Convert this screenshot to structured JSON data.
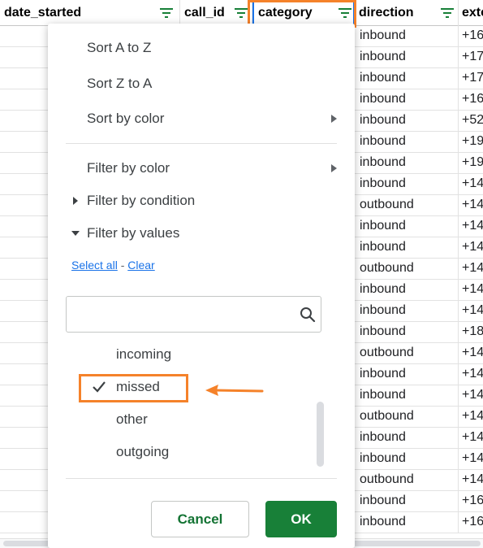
{
  "columns": [
    {
      "label": "date_started",
      "filter_icon": "filter-icon",
      "filter_active": false
    },
    {
      "label": "call_id",
      "filter_icon": "filter-icon",
      "filter_active": false
    },
    {
      "label": "category",
      "filter_icon": "filter-icon",
      "filter_active": true
    },
    {
      "label": "direction",
      "filter_icon": "filter-icon",
      "filter_active": false
    },
    {
      "label": "exte",
      "filter_icon": null,
      "filter_active": false
    }
  ],
  "rows": [
    {
      "direction": "inbound",
      "ext": "+16"
    },
    {
      "direction": "inbound",
      "ext": "+17"
    },
    {
      "direction": "inbound",
      "ext": "+17"
    },
    {
      "direction": "inbound",
      "ext": "+16"
    },
    {
      "direction": "inbound",
      "ext": "+52"
    },
    {
      "direction": "inbound",
      "ext": "+19"
    },
    {
      "direction": "inbound",
      "ext": "+19"
    },
    {
      "direction": "inbound",
      "ext": "+14"
    },
    {
      "direction": "outbound",
      "ext": "+14"
    },
    {
      "direction": "inbound",
      "ext": "+14"
    },
    {
      "direction": "inbound",
      "ext": "+14"
    },
    {
      "direction": "outbound",
      "ext": "+14"
    },
    {
      "direction": "inbound",
      "ext": "+14"
    },
    {
      "direction": "inbound",
      "ext": "+14"
    },
    {
      "direction": "inbound",
      "ext": "+18"
    },
    {
      "direction": "outbound",
      "ext": "+14"
    },
    {
      "direction": "inbound",
      "ext": "+14"
    },
    {
      "direction": "inbound",
      "ext": "+14"
    },
    {
      "direction": "outbound",
      "ext": "+14"
    },
    {
      "direction": "inbound",
      "ext": "+14"
    },
    {
      "direction": "inbound",
      "ext": "+14"
    },
    {
      "direction": "outbound",
      "ext": "+14"
    },
    {
      "direction": "inbound",
      "ext": "+16"
    },
    {
      "direction": "inbound",
      "ext": "+16"
    }
  ],
  "menu": {
    "sort_a_z": "Sort A to Z",
    "sort_z_a": "Sort Z to A",
    "sort_by_color": "Sort by color",
    "filter_by_color": "Filter by color",
    "filter_by_condition": "Filter by condition",
    "filter_by_values": "Filter by values",
    "select_all": "Select all",
    "separator": " - ",
    "clear": "Clear",
    "search_value": "",
    "search_icon": "search-icon",
    "values": [
      {
        "label": "incoming",
        "checked": false
      },
      {
        "label": "missed",
        "checked": true
      },
      {
        "label": "other",
        "checked": false
      },
      {
        "label": "outgoing",
        "checked": false
      }
    ],
    "cancel_label": "Cancel",
    "ok_label": "OK"
  },
  "colors": {
    "highlight": "#f5822a",
    "ok_button": "#188038",
    "cancel_text": "#137333",
    "link": "#1a73e8",
    "filter_icon": "#188038"
  }
}
